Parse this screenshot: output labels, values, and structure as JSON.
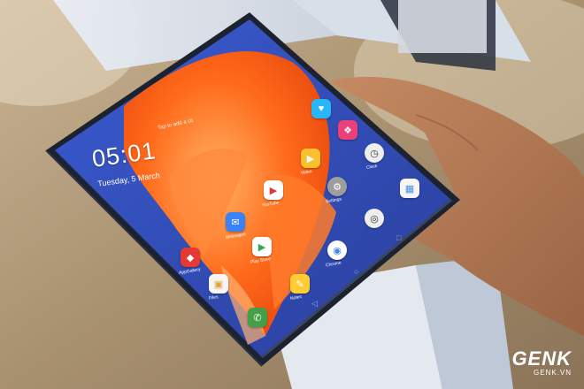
{
  "lockscreen": {
    "time": "05:01",
    "date": "Tuesday, 5 March",
    "status": "Tap to add a cit"
  },
  "apps": [
    {
      "name": "App Gallery",
      "label": "AppGallery",
      "icon": "appgallery-icon",
      "color": "#e53935"
    },
    {
      "name": "Files",
      "label": "Files",
      "icon": "files-icon",
      "color": "#f5f5f5"
    },
    {
      "name": "Phone",
      "label": "Phone",
      "icon": "phone-icon",
      "color": "#43a047"
    },
    {
      "name": "Messages",
      "label": "Messages",
      "icon": "messages-icon",
      "color": "#3b82f6"
    },
    {
      "name": "Play Store",
      "label": "Play Store",
      "icon": "play-store-icon",
      "color": "#ffffff"
    },
    {
      "name": "YouTube",
      "label": "YouTube",
      "icon": "youtube-icon",
      "color": "#ffffff"
    },
    {
      "name": "Chrome",
      "label": "Chrome",
      "icon": "chrome-icon",
      "color": "#ffffff"
    },
    {
      "name": "Notes",
      "label": "Notes",
      "icon": "notes-icon",
      "color": "#ffcc33"
    },
    {
      "name": "Settings",
      "label": "Settings",
      "icon": "settings-icon",
      "color": "#9e9e9e"
    },
    {
      "name": "Camera",
      "label": "Camera",
      "icon": "camera-icon",
      "color": "#eeeeee"
    },
    {
      "name": "Clock",
      "label": "Clock",
      "icon": "clock-icon",
      "color": "#eeeeee"
    },
    {
      "name": "Gallery",
      "label": "Gallery",
      "icon": "gallery-icon",
      "color": "#f5f5f5"
    },
    {
      "name": "Video",
      "label": "Video",
      "icon": "video-icon",
      "color": "#fbc02d"
    },
    {
      "name": "Themes",
      "label": "Themes",
      "icon": "themes-icon",
      "color": "#ec407a"
    },
    {
      "name": "Health",
      "label": "Health",
      "icon": "health-icon",
      "color": "#29b6f6"
    }
  ],
  "watermark": {
    "brand": "GENK",
    "site": "GENK.VN"
  },
  "colors": {
    "wallpaper_orange": "#ff6a1a",
    "wallpaper_blue": "#2c4fb8",
    "bezel": "#1c2230"
  }
}
